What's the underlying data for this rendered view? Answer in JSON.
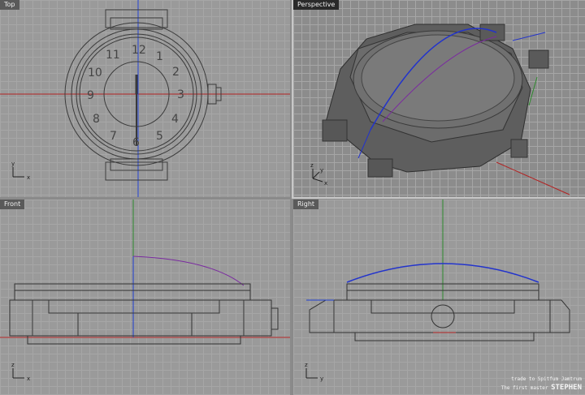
{
  "viewports": {
    "top": {
      "label": "Top"
    },
    "perspective": {
      "label": "Perspective"
    },
    "front": {
      "label": "Front"
    },
    "right": {
      "label": "Right"
    }
  },
  "axes": {
    "x": "x",
    "y": "y",
    "z": "z"
  },
  "dial_numbers": [
    "12",
    "1",
    "2",
    "3",
    "4",
    "5",
    "6",
    "7",
    "8",
    "9",
    "10",
    "11"
  ],
  "credit": {
    "line1": "trade to Spitfum Jamtrum",
    "line2": "The first master",
    "name": "STEPHEN"
  },
  "colors": {
    "x_axis": "#b22222",
    "y_axis": "#2e8b2e",
    "z_axis": "#1e3fd0",
    "curve_blue": "#2233cc",
    "curve_purple": "#7a2aa0"
  }
}
